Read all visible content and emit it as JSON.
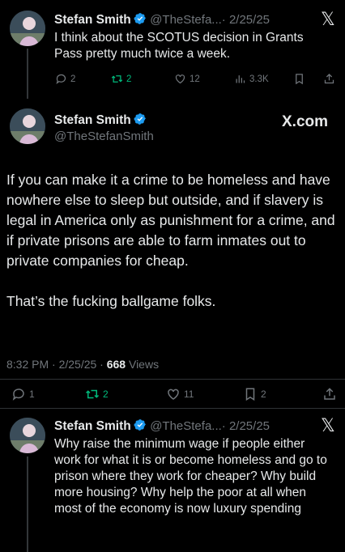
{
  "tweet1": {
    "name": "Stefan Smith",
    "handle": "@TheStefa...",
    "date": "· 2/25/25",
    "text": "I think about the SCOTUS decision in Grants Pass pretty much twice a week.",
    "replies": "2",
    "reposts": "2",
    "likes": "12",
    "views": "3.3K"
  },
  "tweet2": {
    "name": "Stefan Smith",
    "handle": "@TheStefanSmith",
    "brand": "X.com",
    "paragraph1": "If you can make it a crime to be homeless and have nowhere else to sleep but outside, and if slavery is legal in America only as punishment for a crime, and if private prisons are able to farm inmates out to private companies for cheap.",
    "paragraph2": "That’s the fucking ballgame folks.",
    "timestamp": "8:32 PM · 2/25/25 ·",
    "views_count": "668",
    "views_label": "Views",
    "replies": "1",
    "reposts": "2",
    "likes": "11",
    "bookmarks": "2"
  },
  "tweet3": {
    "name": "Stefan Smith",
    "handle": "@TheStefa...",
    "date": "· 2/25/25",
    "text": "Why raise the minimum wage if people either work for what it is or become homeless and go to prison where they work for cheaper? Why build more housing? Why help the poor at all when most of the economy is now luxury spending"
  },
  "colors": {
    "background": "#000000",
    "text": "#e7e9ea",
    "muted": "#71767b",
    "verified": "#1d9bf0",
    "repost": "#00ba7c"
  }
}
